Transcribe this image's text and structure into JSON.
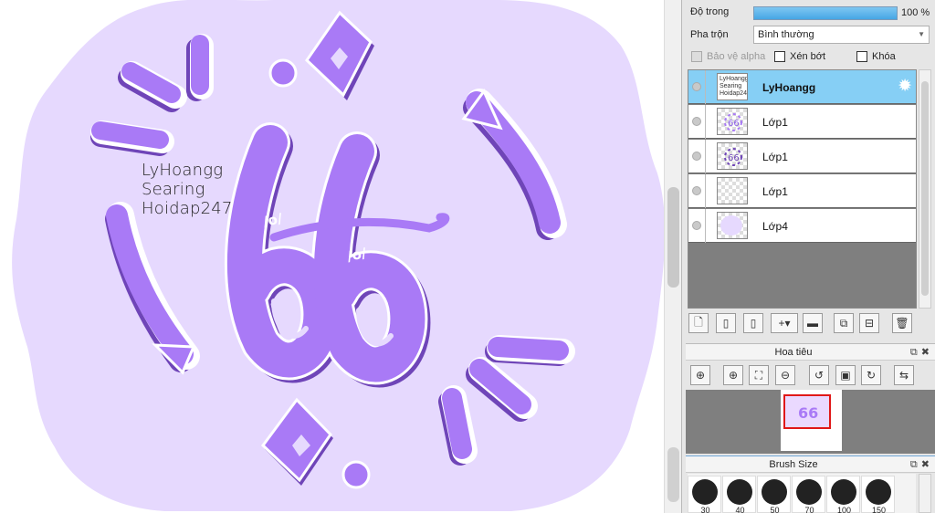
{
  "canvas": {
    "text_lines": [
      "LyHoangg",
      "Searing",
      "Hoidap247"
    ],
    "doodle_left": "/o/",
    "doodle_right": "/o/",
    "colors": {
      "background_blob": "#e6d9fe",
      "purple": "#a97af6",
      "shadow": "#6f45b8",
      "outline": "#ffffff"
    }
  },
  "panel": {
    "opacity_label": "Độ trong",
    "opacity_value": "100 %",
    "blend_label": "Pha trộn",
    "blend_value": "Bình thường",
    "protect_alpha": "Bảo vệ alpha",
    "clipping": "Xén bớt",
    "lock": "Khóa",
    "layers": [
      {
        "name": "LyHoangg",
        "selected": true
      },
      {
        "name": "Lớp1",
        "selected": false
      },
      {
        "name": "Lớp1",
        "selected": false
      },
      {
        "name": "Lớp1",
        "selected": false
      },
      {
        "name": "Lớp4",
        "selected": false
      }
    ],
    "thumb_text": [
      "LyHoangg",
      "Searing",
      "Hoidap247"
    ],
    "navigator_title": "Hoa tiêu",
    "brush_title": "Brush Size",
    "brush_sizes": [
      "30",
      "40",
      "50",
      "70",
      "100",
      "150"
    ],
    "accent_color": "#86cff5"
  }
}
